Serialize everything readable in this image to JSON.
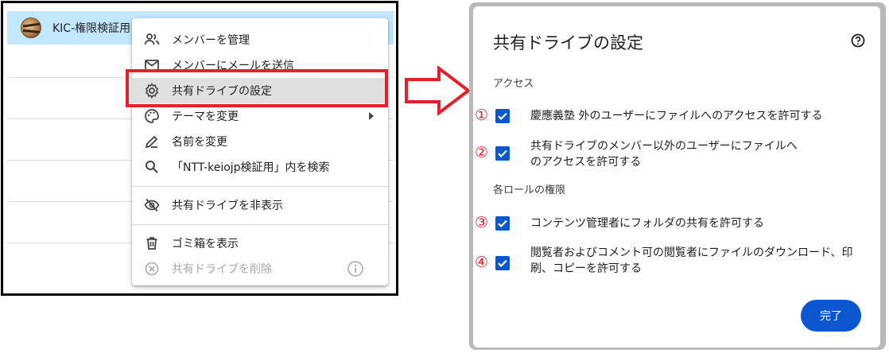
{
  "left": {
    "drive_name": "KIC-権限検証用",
    "menu": {
      "items": [
        {
          "label": "メンバーを管理",
          "icon": "manage-members-icon"
        },
        {
          "label": "メンバーにメールを送信",
          "icon": "mail-icon"
        },
        {
          "label": "共有ドライブの設定",
          "icon": "gear-icon"
        },
        {
          "label": "テーマを変更",
          "icon": "palette-icon"
        },
        {
          "label": "名前を変更",
          "icon": "pencil-icon"
        },
        {
          "label": "「NTT-keiojp検証用」内を検索",
          "icon": "search-icon"
        },
        {
          "label": "共有ドライブを非表示",
          "icon": "eye-off-icon"
        },
        {
          "label": "ゴミ箱を表示",
          "icon": "trash-icon"
        },
        {
          "label": "共有ドライブを削除",
          "icon": "delete-circle-icon"
        }
      ],
      "highlighted_index": 2,
      "disabled_index": 8
    }
  },
  "dialog": {
    "title": "共有ドライブの設定",
    "section_access": "アクセス",
    "section_roles": "各ロールの権限",
    "options": [
      {
        "number": "①",
        "text": "慶應義塾 外のユーザーにファイルへのアクセスを許可する",
        "checked": true
      },
      {
        "number": "②",
        "text": "共有ドライブのメンバー以外のユーザーにファイルへのアクセスを許可する",
        "checked": true
      },
      {
        "number": "③",
        "text": "コンテンツ管理者にフォルダの共有を許可する",
        "checked": true
      },
      {
        "number": "④",
        "text": "閲覧者およびコメント可の閲覧者にファイルのダウンロード、印刷、コピーを許可する",
        "checked": true
      }
    ],
    "done_label": "完了"
  },
  "colors": {
    "accent_blue": "#0b57d0",
    "selection_blue": "#c2e7ff",
    "annotation_red": "#e3202b"
  }
}
